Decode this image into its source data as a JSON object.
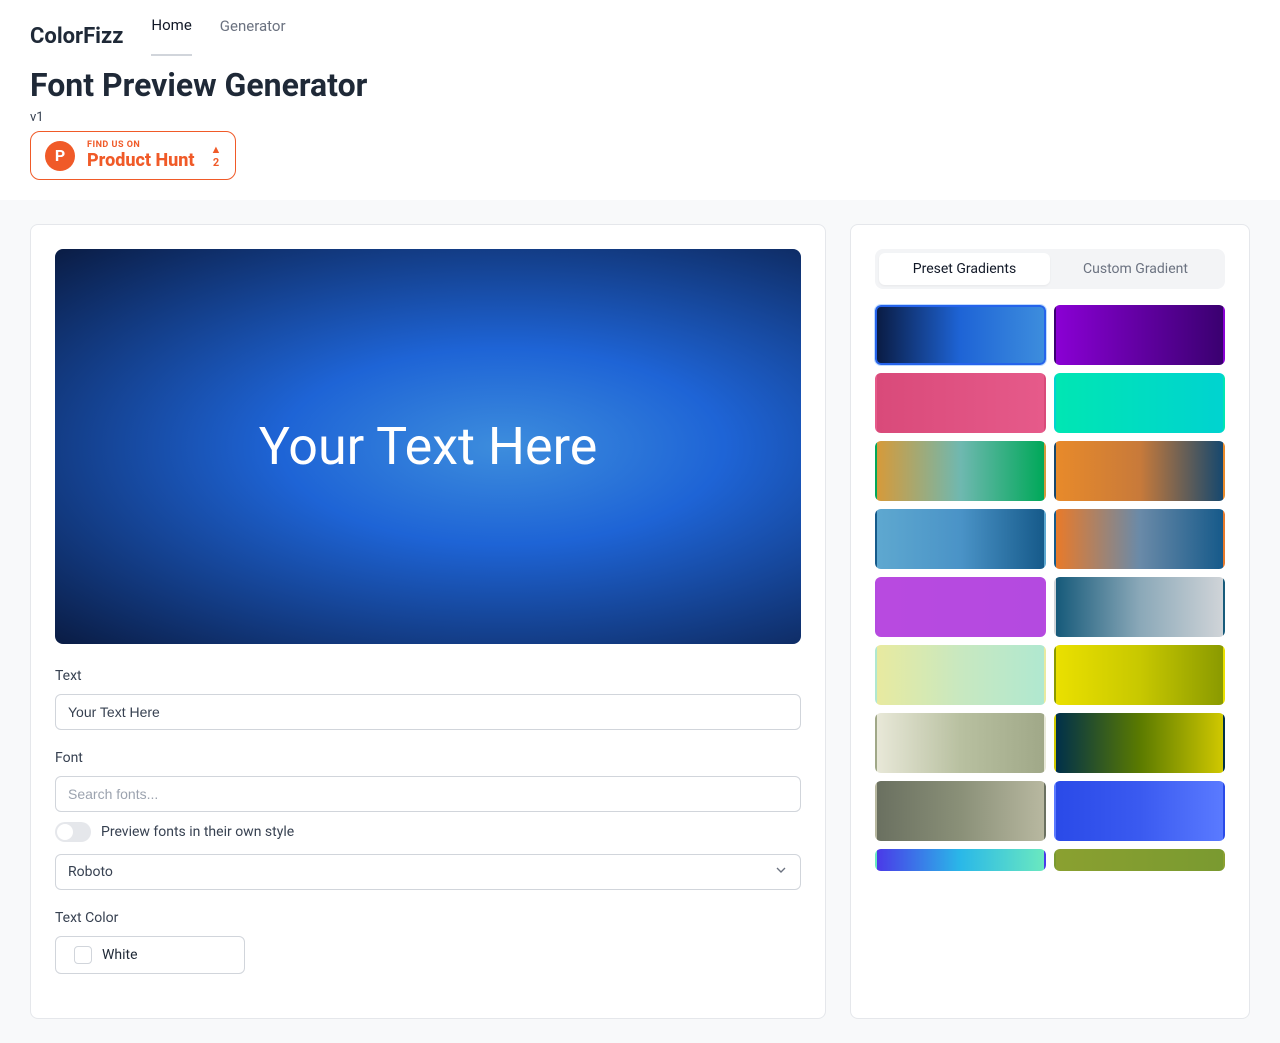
{
  "brand": "ColorFizz",
  "nav": {
    "home": "Home",
    "generator": "Generator"
  },
  "page_title": "Font Preview Generator",
  "version": "v1",
  "product_hunt": {
    "sub": "FIND US ON",
    "main": "Product Hunt",
    "count": "2"
  },
  "preview_text": "Your Text Here",
  "form": {
    "text_label": "Text",
    "text_value": "Your Text Here",
    "font_label": "Font",
    "font_search_placeholder": "Search fonts...",
    "preview_toggle_label": "Preview fonts in their own style",
    "selected_font": "Roboto",
    "text_color_label": "Text Color",
    "text_color_value": "White"
  },
  "sidebar": {
    "tab_presets": "Preset Gradients",
    "tab_custom": "Custom Gradient"
  },
  "gradients": [
    {
      "name": "deep-blue",
      "css": "linear-gradient(90deg,#0a1c44,#1e64d6,#3d8ddd)",
      "selected": true
    },
    {
      "name": "purple",
      "css": "linear-gradient(90deg,#8a00d4,#3a0070)"
    },
    {
      "name": "pink-rose",
      "css": "linear-gradient(90deg,#d94a7a,#e65a8a)"
    },
    {
      "name": "teal",
      "css": "linear-gradient(90deg,#00e6b3,#00d3d0)"
    },
    {
      "name": "orange-green",
      "css": "linear-gradient(90deg,#d69a3a,#6fb8b0,#00a859)"
    },
    {
      "name": "orange-navy",
      "css": "linear-gradient(90deg,#e88a2a,#c87a3a,#16486e)"
    },
    {
      "name": "light-blue-navy",
      "css": "linear-gradient(90deg,#5ea8d0,#4a93c7,#165a8a)"
    },
    {
      "name": "orange-blue",
      "css": "linear-gradient(90deg,#e87a2a,#6a8aa8,#165a8a)"
    },
    {
      "name": "violet",
      "css": "linear-gradient(90deg,#b84ae0,#b44ae0)"
    },
    {
      "name": "steel-grey",
      "css": "linear-gradient(90deg,#165a7a,#8aa8b8,#d0d4d8)"
    },
    {
      "name": "pale-mint",
      "css": "linear-gradient(90deg,#e8eaa0,#c8e8c0,#b0e8d0)"
    },
    {
      "name": "yellow-olive",
      "css": "linear-gradient(90deg,#eae000,#c8c800,#8a9a00)"
    },
    {
      "name": "sage",
      "css": "linear-gradient(90deg,#e8e8d8,#b8c0a0,#a0a888)"
    },
    {
      "name": "navy-yellow",
      "css": "linear-gradient(90deg,#00304a,#5a7a00,#d0c800)"
    },
    {
      "name": "olive-grey",
      "css": "linear-gradient(90deg,#6a7060,#8a9078,#b8b8a0)"
    },
    {
      "name": "royal-blue",
      "css": "linear-gradient(90deg,#2a4ae8,#3a5af0,#5a7aff)"
    },
    {
      "name": "blue-cyan-mint",
      "css": "linear-gradient(90deg,#4a3ae8,#2ab8e8,#6ae8c0)",
      "half": true
    },
    {
      "name": "olive-green",
      "css": "linear-gradient(90deg,#8aa030,#7a9a30)",
      "half": true
    }
  ],
  "colors": {
    "preview_gradient": "radial-gradient(ellipse at 60% 50%, #3d8ddd 0%, #1e64d6 35%, #0a1c44 100%)"
  }
}
